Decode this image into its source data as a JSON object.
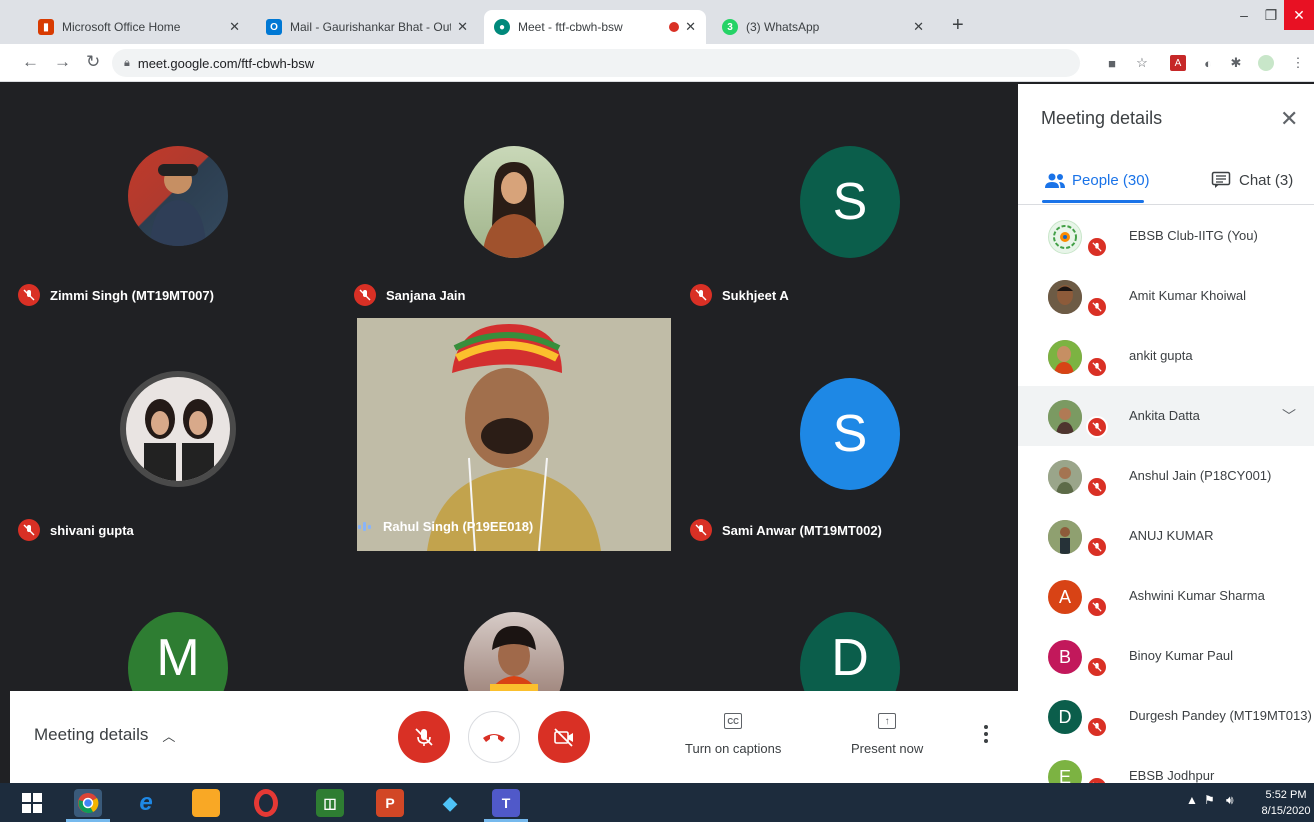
{
  "browser": {
    "tabs": [
      {
        "title": "Microsoft Office Home",
        "favicon": "office-icon",
        "color": "#d83b01"
      },
      {
        "title": "Mail - Gaurishankar Bhat - Outlo",
        "favicon": "outlook-icon",
        "color": "#0078d4"
      },
      {
        "title": "Meet - ftf-cbwh-bsw",
        "favicon": "meet-icon",
        "color": "#00897b"
      },
      {
        "title": "(3) WhatsApp",
        "favicon": "whatsapp-icon",
        "color": "#25d366"
      }
    ],
    "url": "meet.google.com/ftf-cbwh-bsw"
  },
  "stage": {
    "tiles": [
      {
        "name": "Zimmi Singh (MT19MT007)",
        "initial": "",
        "color": "#c0392b"
      },
      {
        "name": "Sanjana Jain",
        "initial": "",
        "color": "#8d6e63"
      },
      {
        "name": "Sukhjeet A",
        "initial": "S",
        "color": "#0b5e4b"
      },
      {
        "name": "shivani gupta",
        "initial": "",
        "color": "#9e9e9e"
      },
      {
        "name": "Rahul Singh (P19EE018)",
        "initial": "",
        "color": "#b5ad93"
      },
      {
        "name": "Sami Anwar (MT19MT002)",
        "initial": "S",
        "color": "#1e88e5"
      },
      {
        "name": "",
        "initial": "M",
        "color": "#2e7d32"
      },
      {
        "name": "",
        "initial": "",
        "color": "#d84315"
      },
      {
        "name": "",
        "initial": "D",
        "color": "#0b5e4b"
      }
    ]
  },
  "controls": {
    "meeting_details": "Meeting details",
    "captions": "Turn on captions",
    "present": "Present now",
    "captions_icon": "CC"
  },
  "panel": {
    "title": "Meeting details",
    "people_tab": "People (30)",
    "chat_tab": "Chat (3)",
    "participants": [
      {
        "name": "EBSB Club-IITG (You)",
        "initial": "",
        "color": "#e8f5e9"
      },
      {
        "name": "Amit Kumar Khoiwal",
        "initial": "",
        "color": "#5d4037"
      },
      {
        "name": "ankit gupta",
        "initial": "",
        "color": "#8d6e63"
      },
      {
        "name": "Ankita Datta",
        "initial": "",
        "color": "#6d8b5a"
      },
      {
        "name": "Anshul Jain (P18CY001)",
        "initial": "",
        "color": "#7e8c6e"
      },
      {
        "name": "ANUJ KUMAR",
        "initial": "",
        "color": "#6b6f4a"
      },
      {
        "name": "Ashwini Kumar Sharma",
        "initial": "A",
        "color": "#d84315"
      },
      {
        "name": "Binoy Kumar Paul",
        "initial": "B",
        "color": "#c2185b"
      },
      {
        "name": "Durgesh Pandey (MT19MT013)",
        "initial": "D",
        "color": "#0b5e4b"
      },
      {
        "name": "EBSB Jodhpur",
        "initial": "E",
        "color": "#7cb342"
      }
    ]
  },
  "taskbar": {
    "time": "5:52 PM",
    "date": "8/15/2020"
  }
}
